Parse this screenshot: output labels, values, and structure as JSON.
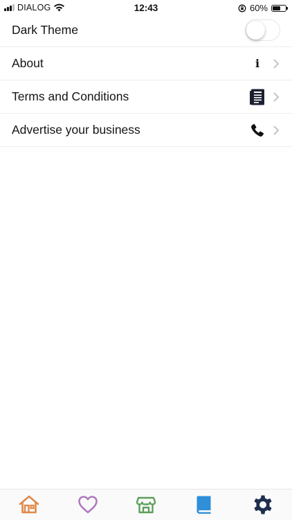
{
  "status_bar": {
    "carrier": "DIALOG",
    "time": "12:43",
    "battery_percent": "60%",
    "battery_level": 0.6
  },
  "settings": {
    "dark_theme": {
      "label": "Dark Theme",
      "enabled": false
    },
    "about": {
      "label": "About",
      "icon": "info-icon",
      "glyph": "i"
    },
    "terms": {
      "label": "Terms and Conditions",
      "icon": "document-icon"
    },
    "advertise": {
      "label": "Advertise your business",
      "icon": "phone-icon"
    }
  },
  "tab_bar": {
    "tabs": [
      {
        "name": "home",
        "icon": "home-icon",
        "color": "#E0894A"
      },
      {
        "name": "favorites",
        "icon": "heart-icon",
        "color": "#B07AC0"
      },
      {
        "name": "store",
        "icon": "store-icon",
        "color": "#5E9E5A"
      },
      {
        "name": "book",
        "icon": "book-icon",
        "color": "#2F8FD8"
      },
      {
        "name": "settings",
        "icon": "gear-icon",
        "color": "#1E2E4E"
      }
    ]
  }
}
